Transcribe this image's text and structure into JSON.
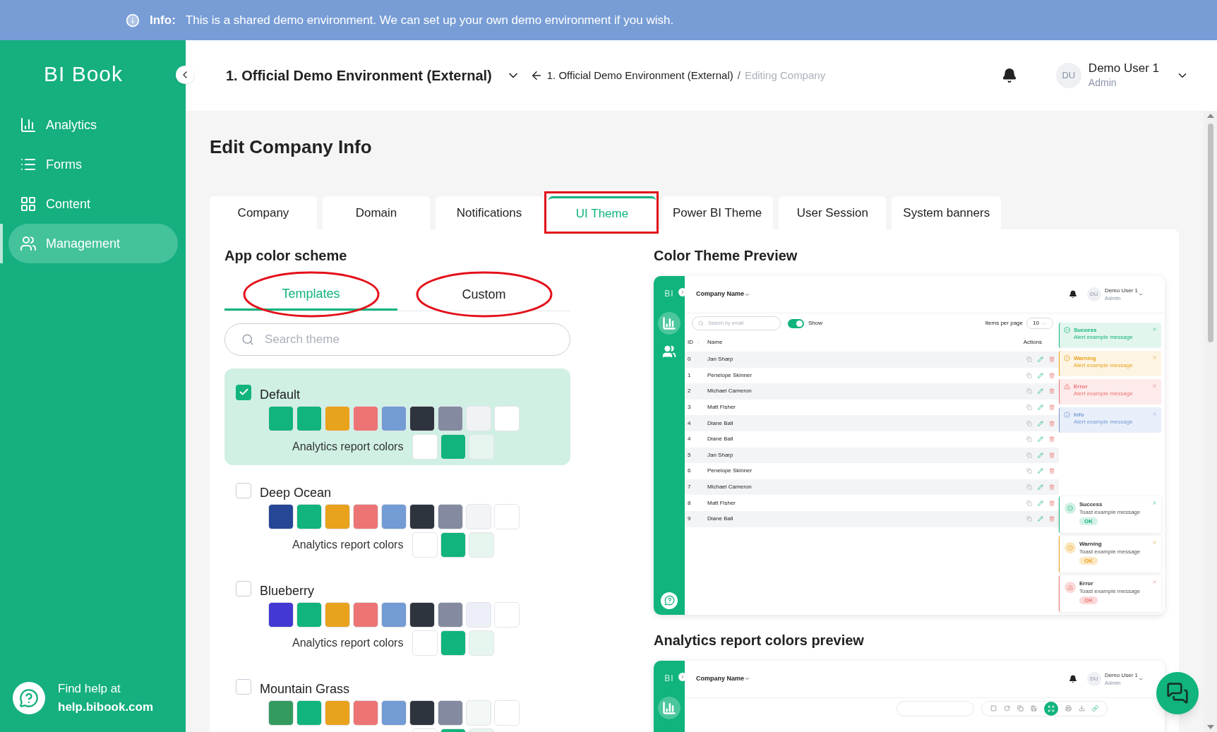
{
  "banner": {
    "label": "Info:",
    "text": "This is a shared demo environment. We can set up your own demo environment if you wish."
  },
  "sidebar": {
    "logo": "BI Book",
    "items": [
      {
        "label": "Analytics",
        "kind": "chart",
        "selected": false
      },
      {
        "label": "Forms",
        "kind": "list",
        "selected": false
      },
      {
        "label": "Content",
        "kind": "grid",
        "selected": false
      },
      {
        "label": "Management",
        "kind": "users",
        "selected": true
      }
    ],
    "help": {
      "text": "Find help at",
      "link": "help.bibook.com"
    }
  },
  "header": {
    "environment": "1. Official Demo Environment (External)",
    "breadcrumb": [
      "1. Official Demo Environment (External)"
    ],
    "separator": "/",
    "current": "Editing Company",
    "user": {
      "initials": "DU",
      "name": "Demo User 1",
      "role": "Admin"
    }
  },
  "title": "Edit Company Info",
  "tabs": [
    {
      "label": "Company",
      "selected": false,
      "annotated": false
    },
    {
      "label": "Domain",
      "selected": false,
      "annotated": false
    },
    {
      "label": "Notifications",
      "selected": false,
      "annotated": false
    },
    {
      "label": "UI Theme",
      "selected": true,
      "annotated": true
    },
    {
      "label": "Power BI Theme",
      "selected": false,
      "annotated": false
    },
    {
      "label": "User Session",
      "selected": false,
      "annotated": false
    },
    {
      "label": "System banners",
      "selected": false,
      "annotated": false
    }
  ],
  "scheme": {
    "title": "App color scheme",
    "subtabs": [
      {
        "label": "Templates",
        "selected": true,
        "annotated": true
      },
      {
        "label": "Custom",
        "selected": false,
        "annotated": true
      }
    ],
    "search": {
      "placeholder": "Search theme"
    },
    "themes": [
      {
        "name": "Default",
        "checked": true,
        "swatches": [
          {
            "color": "#10b47c"
          },
          {
            "color": "#10b47c"
          },
          {
            "color": "#e8a21c"
          },
          {
            "color": "#ec7474"
          },
          {
            "color": "#739bd4"
          },
          {
            "color": "#2e343d"
          },
          {
            "color": "#848ba0"
          },
          {
            "color": "#f1f2f5"
          },
          {
            "color": "#ffffff"
          }
        ],
        "report_label": "Analytics report colors",
        "report_swatches": [
          {
            "color": "#ffffff"
          },
          {
            "color": "#10b47c"
          },
          {
            "color": "#e6f6ef"
          }
        ]
      },
      {
        "name": "Deep Ocean",
        "checked": false,
        "swatches": [
          {
            "color": "#264796"
          },
          {
            "color": "#10b47c"
          },
          {
            "color": "#e8a21c"
          },
          {
            "color": "#ec7474"
          },
          {
            "color": "#739bd4"
          },
          {
            "color": "#2e343d"
          },
          {
            "color": "#848ba0"
          },
          {
            "color": "#f3f4f6"
          },
          {
            "color": "#ffffff"
          }
        ],
        "report_label": "Analytics report colors",
        "report_swatches": [
          {
            "color": "#ffffff"
          },
          {
            "color": "#10b47c"
          },
          {
            "color": "#e6f6ef"
          }
        ]
      },
      {
        "name": "Blueberry",
        "checked": false,
        "swatches": [
          {
            "color": "#4338d2"
          },
          {
            "color": "#10b47c"
          },
          {
            "color": "#e8a21c"
          },
          {
            "color": "#ec7474"
          },
          {
            "color": "#739bd4"
          },
          {
            "color": "#2e343d"
          },
          {
            "color": "#848ba0"
          },
          {
            "color": "#eceff7"
          },
          {
            "color": "#ffffff"
          }
        ],
        "report_label": "Analytics report colors",
        "report_swatches": [
          {
            "color": "#ffffff"
          },
          {
            "color": "#10b47c"
          },
          {
            "color": "#e6f6ef"
          }
        ]
      },
      {
        "name": "Mountain Grass",
        "checked": false,
        "swatches": [
          {
            "color": "#349b5f"
          },
          {
            "color": "#10b47c"
          },
          {
            "color": "#e8a21c"
          },
          {
            "color": "#ec7474"
          },
          {
            "color": "#739bd4"
          },
          {
            "color": "#2e343d"
          },
          {
            "color": "#848ba0"
          },
          {
            "color": "#f3f7f5"
          },
          {
            "color": "#ffffff"
          }
        ],
        "report_swatches": [
          {
            "color": "#ffffff"
          },
          {
            "color": "#10b47c"
          },
          {
            "color": "#e6f6ef"
          }
        ]
      }
    ]
  },
  "preview": {
    "title": "Color Theme Preview",
    "logo": "BI",
    "company": "Company Name",
    "search_placeholder": "Search by email",
    "toggle": {
      "label": "Show",
      "on": true
    },
    "per_page_label": "Items per page",
    "per_page": "10",
    "columns": [
      "ID",
      "Name",
      "Actions"
    ],
    "rows": [
      {
        "id": "0",
        "name": "Jan Sharp"
      },
      {
        "id": "1",
        "name": "Penelope Skinner"
      },
      {
        "id": "2",
        "name": "Michael Cameron"
      },
      {
        "id": "3",
        "name": "Matt Fisher"
      },
      {
        "id": "4",
        "name": "Diane Ball"
      },
      {
        "id": "4",
        "name": "Diane Ball"
      },
      {
        "id": "5",
        "name": "Jan Sharp"
      },
      {
        "id": "6",
        "name": "Penelope Skinner"
      },
      {
        "id": "7",
        "name": "Michael Cameron"
      },
      {
        "id": "8",
        "name": "Matt Fisher"
      },
      {
        "id": "9",
        "name": "Diane Ball"
      }
    ],
    "user": {
      "initials": "DU",
      "name": "Demo User 1",
      "role": "Admin"
    },
    "alerts": [
      {
        "kind": "success",
        "title": "Success",
        "message": "Alert example message"
      },
      {
        "kind": "warning",
        "title": "Warning",
        "message": "Alert example message"
      },
      {
        "kind": "error",
        "title": "Error",
        "message": "Alert example message"
      },
      {
        "kind": "info",
        "title": "Info",
        "message": "Alert example message"
      }
    ],
    "toasts": [
      {
        "kind": "success",
        "title": "Success",
        "message": "Toast example message",
        "button": "OK"
      },
      {
        "kind": "warning",
        "title": "Warning",
        "message": "Toast example message",
        "button": "OK"
      },
      {
        "kind": "error",
        "title": "Error",
        "message": "Toast example message",
        "button": "OK"
      }
    ]
  },
  "report_preview": {
    "title": "Analytics report colors preview",
    "logo": "BI",
    "company": "Company Name",
    "user": {
      "initials": "DU",
      "name": "Demo User 1",
      "role": "Admin"
    }
  }
}
